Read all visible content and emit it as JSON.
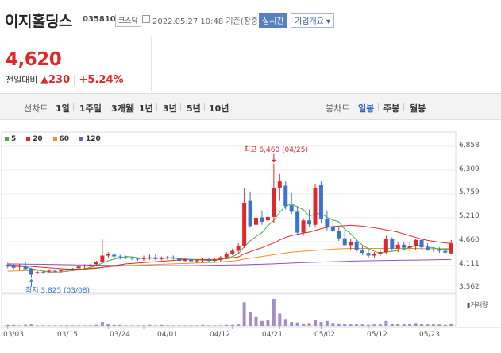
{
  "header": {
    "name": "이지홀딩스",
    "code": "035810",
    "market": "코스닥",
    "datetime": "2022.05.27 10:48 기준(장중)",
    "realtime_label": "실시간",
    "info_label": "기업개요 ▾"
  },
  "quote": {
    "price": "4,620",
    "change_label": "전일대비",
    "change_arrow": "▲",
    "change": "230",
    "percent": "+5.24%"
  },
  "tabs": {
    "line_label": "선차트",
    "line_items": [
      "1일",
      "1주일",
      "3개월",
      "1년",
      "3년",
      "5년",
      "10년"
    ],
    "candle_label": "봉차트",
    "candle_items": [
      "일봉",
      "주봉",
      "월봉"
    ],
    "selected": "일봉"
  },
  "legend": [
    {
      "label": "5",
      "color": "#3fae3f"
    },
    {
      "label": "20",
      "color": "#e0282b"
    },
    {
      "label": "60",
      "color": "#f0901e"
    },
    {
      "label": "120",
      "color": "#8a55b8"
    }
  ],
  "annotations": {
    "high": "최고 6,460 (04/25)",
    "low": "최저 3,825 (03/08)"
  },
  "volume_label": "▮거래량",
  "colors": {
    "up": "#e0282b",
    "down": "#3a74cf",
    "accent": "#2f5fbf"
  },
  "chart_data": {
    "type": "candlestick",
    "y_ticks": [
      6858,
      6309,
      5759,
      5210,
      4660,
      4111,
      3562
    ],
    "y_tick_labels": [
      "6,858",
      "6,309",
      "5,759",
      "5,210",
      "4,660",
      "4,111",
      "3,562"
    ],
    "x_tick_labels": [
      "03/03",
      "03/15",
      "03/24",
      "04/01",
      "04/12",
      "04/21",
      "05/02",
      "05/12",
      "05/23"
    ],
    "ylim": [
      3562,
      6858
    ],
    "candles": [
      {
        "o": 4130,
        "h": 4180,
        "l": 4050,
        "c": 4090
      },
      {
        "o": 4100,
        "h": 4140,
        "l": 4030,
        "c": 4060
      },
      {
        "o": 4080,
        "h": 4150,
        "l": 4000,
        "c": 4120
      },
      {
        "o": 4110,
        "h": 4190,
        "l": 4010,
        "c": 4030
      },
      {
        "o": 4040,
        "h": 4060,
        "l": 3825,
        "c": 3900
      },
      {
        "o": 3950,
        "h": 4000,
        "l": 3900,
        "c": 3960
      },
      {
        "o": 3960,
        "h": 3990,
        "l": 3920,
        "c": 3940
      },
      {
        "o": 3980,
        "h": 4030,
        "l": 3950,
        "c": 3990
      },
      {
        "o": 3990,
        "h": 4010,
        "l": 3960,
        "c": 3980
      },
      {
        "o": 3990,
        "h": 4020,
        "l": 3950,
        "c": 4000
      },
      {
        "o": 4000,
        "h": 4050,
        "l": 3970,
        "c": 4030
      },
      {
        "o": 4030,
        "h": 4060,
        "l": 3990,
        "c": 4040
      },
      {
        "o": 4050,
        "h": 4110,
        "l": 4020,
        "c": 4090
      },
      {
        "o": 4090,
        "h": 4140,
        "l": 4040,
        "c": 4110
      },
      {
        "o": 4110,
        "h": 4150,
        "l": 4080,
        "c": 4130
      },
      {
        "o": 4140,
        "h": 4220,
        "l": 4110,
        "c": 4190
      },
      {
        "o": 4200,
        "h": 4730,
        "l": 4180,
        "c": 4340
      },
      {
        "o": 4340,
        "h": 4420,
        "l": 4280,
        "c": 4380
      },
      {
        "o": 4360,
        "h": 4400,
        "l": 4290,
        "c": 4320
      },
      {
        "o": 4320,
        "h": 4360,
        "l": 4250,
        "c": 4300
      },
      {
        "o": 4300,
        "h": 4340,
        "l": 4260,
        "c": 4290
      },
      {
        "o": 4290,
        "h": 4320,
        "l": 4240,
        "c": 4270
      },
      {
        "o": 4270,
        "h": 4300,
        "l": 4220,
        "c": 4260
      },
      {
        "o": 4260,
        "h": 4340,
        "l": 4220,
        "c": 4280
      },
      {
        "o": 4280,
        "h": 4360,
        "l": 4240,
        "c": 4300
      },
      {
        "o": 4300,
        "h": 4380,
        "l": 4240,
        "c": 4260
      },
      {
        "o": 4260,
        "h": 4320,
        "l": 4230,
        "c": 4290
      },
      {
        "o": 4290,
        "h": 4330,
        "l": 4250,
        "c": 4300
      },
      {
        "o": 4300,
        "h": 4340,
        "l": 4250,
        "c": 4270
      },
      {
        "o": 4270,
        "h": 4300,
        "l": 4200,
        "c": 4220
      },
      {
        "o": 4220,
        "h": 4290,
        "l": 4200,
        "c": 4260
      },
      {
        "o": 4260,
        "h": 4300,
        "l": 4190,
        "c": 4210
      },
      {
        "o": 4210,
        "h": 4260,
        "l": 4170,
        "c": 4230
      },
      {
        "o": 4230,
        "h": 4280,
        "l": 4190,
        "c": 4250
      },
      {
        "o": 4250,
        "h": 4300,
        "l": 4200,
        "c": 4220
      },
      {
        "o": 4220,
        "h": 4280,
        "l": 4190,
        "c": 4240
      },
      {
        "o": 4240,
        "h": 4330,
        "l": 4200,
        "c": 4300
      },
      {
        "o": 4300,
        "h": 4420,
        "l": 4260,
        "c": 4380
      },
      {
        "o": 4380,
        "h": 4500,
        "l": 4350,
        "c": 4450
      },
      {
        "o": 4450,
        "h": 4620,
        "l": 4380,
        "c": 4560
      },
      {
        "o": 4560,
        "h": 5900,
        "l": 4520,
        "c": 5560
      },
      {
        "o": 5600,
        "h": 5820,
        "l": 4980,
        "c": 5020
      },
      {
        "o": 5050,
        "h": 5600,
        "l": 4990,
        "c": 5210
      },
      {
        "o": 5220,
        "h": 5380,
        "l": 5050,
        "c": 5120
      },
      {
        "o": 5150,
        "h": 5320,
        "l": 5000,
        "c": 5230
      },
      {
        "o": 5230,
        "h": 6460,
        "l": 5100,
        "c": 5900
      },
      {
        "o": 5900,
        "h": 6220,
        "l": 5600,
        "c": 6050
      },
      {
        "o": 5950,
        "h": 6050,
        "l": 5400,
        "c": 5480
      },
      {
        "o": 5500,
        "h": 5780,
        "l": 5300,
        "c": 5350
      },
      {
        "o": 5350,
        "h": 5480,
        "l": 4800,
        "c": 4870
      },
      {
        "o": 4870,
        "h": 5200,
        "l": 4800,
        "c": 5150
      },
      {
        "o": 5150,
        "h": 5400,
        "l": 5000,
        "c": 5060
      },
      {
        "o": 5050,
        "h": 6000,
        "l": 5000,
        "c": 5900
      },
      {
        "o": 5960,
        "h": 6050,
        "l": 5100,
        "c": 5180
      },
      {
        "o": 5180,
        "h": 5380,
        "l": 4920,
        "c": 5000
      },
      {
        "o": 5000,
        "h": 5150,
        "l": 4880,
        "c": 4910
      },
      {
        "o": 4900,
        "h": 5000,
        "l": 4680,
        "c": 4740
      },
      {
        "o": 4740,
        "h": 4900,
        "l": 4550,
        "c": 4580
      },
      {
        "o": 4580,
        "h": 4720,
        "l": 4480,
        "c": 4650
      },
      {
        "o": 4650,
        "h": 4720,
        "l": 4430,
        "c": 4470
      },
      {
        "o": 4470,
        "h": 4560,
        "l": 4350,
        "c": 4400
      },
      {
        "o": 4400,
        "h": 4480,
        "l": 4280,
        "c": 4340
      },
      {
        "o": 4340,
        "h": 4420,
        "l": 4300,
        "c": 4380
      },
      {
        "o": 4380,
        "h": 4480,
        "l": 4330,
        "c": 4420
      },
      {
        "o": 4420,
        "h": 4800,
        "l": 4380,
        "c": 4720
      },
      {
        "o": 4720,
        "h": 4760,
        "l": 4450,
        "c": 4500
      },
      {
        "o": 4500,
        "h": 4640,
        "l": 4420,
        "c": 4590
      },
      {
        "o": 4590,
        "h": 4660,
        "l": 4470,
        "c": 4520
      },
      {
        "o": 4520,
        "h": 4650,
        "l": 4440,
        "c": 4560
      },
      {
        "o": 4560,
        "h": 4720,
        "l": 4470,
        "c": 4700
      },
      {
        "o": 4700,
        "h": 4720,
        "l": 4480,
        "c": 4530
      },
      {
        "o": 4530,
        "h": 4620,
        "l": 4450,
        "c": 4480
      },
      {
        "o": 4480,
        "h": 4540,
        "l": 4420,
        "c": 4470
      },
      {
        "o": 4480,
        "h": 4530,
        "l": 4400,
        "c": 4450
      },
      {
        "o": 4450,
        "h": 4520,
        "l": 4380,
        "c": 4410
      },
      {
        "o": 4390,
        "h": 4700,
        "l": 4380,
        "c": 4620
      }
    ],
    "ma": {
      "5": [
        4100,
        4095,
        4090,
        4080,
        4040,
        4010,
        3980,
        3960,
        3960,
        3965,
        3980,
        3995,
        4010,
        4040,
        4070,
        4105,
        4170,
        4220,
        4260,
        4290,
        4320,
        4310,
        4290,
        4280,
        4280,
        4285,
        4285,
        4280,
        4285,
        4270,
        4260,
        4250,
        4240,
        4240,
        4230,
        4235,
        4250,
        4280,
        4320,
        4380,
        4540,
        4680,
        4780,
        4870,
        5030,
        5150,
        5340,
        5480,
        5530,
        5460,
        5400,
        5250,
        5300,
        5310,
        5220,
        5160,
        5120,
        4950,
        4840,
        4700,
        4580,
        4500,
        4440,
        4400,
        4420,
        4440,
        4460,
        4480,
        4530,
        4570,
        4580,
        4540,
        4520,
        4490,
        4480,
        4500
      ],
      "20": [
        4130,
        4120,
        4110,
        4100,
        4090,
        4080,
        4070,
        4060,
        4050,
        4040,
        4030,
        4030,
        4030,
        4030,
        4040,
        4050,
        4070,
        4090,
        4110,
        4130,
        4150,
        4160,
        4170,
        4180,
        4190,
        4200,
        4210,
        4220,
        4230,
        4240,
        4250,
        4250,
        4250,
        4250,
        4250,
        4250,
        4260,
        4270,
        4290,
        4310,
        4380,
        4430,
        4480,
        4520,
        4580,
        4630,
        4700,
        4760,
        4800,
        4830,
        4860,
        4880,
        4920,
        4960,
        4990,
        5010,
        5020,
        5030,
        5040,
        5030,
        5020,
        5000,
        4980,
        4960,
        4930,
        4910,
        4880,
        4840,
        4800,
        4760,
        4720,
        4690,
        4670,
        4650,
        4630,
        4620
      ],
      "60": [
        3980,
        3985,
        3990,
        3995,
        4000,
        4005,
        4005,
        4005,
        4010,
        4015,
        4020,
        4025,
        4030,
        4040,
        4050,
        4060,
        4070,
        4080,
        4090,
        4100,
        4110,
        4115,
        4120,
        4125,
        4130,
        4135,
        4140,
        4145,
        4150,
        4155,
        4160,
        4165,
        4170,
        4175,
        4180,
        4185,
        4195,
        4205,
        4215,
        4230,
        4260,
        4280,
        4300,
        4320,
        4340,
        4360,
        4380,
        4400,
        4420,
        4430,
        4440,
        4450,
        4460,
        4470,
        4480,
        4490,
        4495,
        4500,
        4505,
        4505,
        4505,
        4505,
        4505,
        4505,
        4505,
        4505,
        4505,
        4505,
        4505,
        4505,
        4500,
        4500,
        4500,
        4500,
        4500,
        4500
      ],
      "120": [
        4150,
        4148,
        4146,
        4144,
        4142,
        4140,
        4138,
        4136,
        4134,
        4132,
        4130,
        4128,
        4126,
        4124,
        4122,
        4120,
        4118,
        4117,
        4116,
        4115,
        4114,
        4113,
        4112,
        4111,
        4110,
        4110,
        4110,
        4110,
        4110,
        4110,
        4110,
        4110,
        4112,
        4114,
        4116,
        4118,
        4120,
        4122,
        4124,
        4126,
        4130,
        4134,
        4138,
        4142,
        4146,
        4150,
        4156,
        4162,
        4168,
        4174,
        4180,
        4184,
        4188,
        4192,
        4196,
        4200,
        4204,
        4208,
        4212,
        4216,
        4220,
        4222,
        4224,
        4226,
        4228,
        4230,
        4232,
        4234,
        4236,
        4238,
        4240,
        4242,
        4244,
        4246,
        4248,
        4250
      ]
    },
    "volume": [
      2,
      2,
      1,
      2,
      3,
      1,
      1,
      1,
      1,
      1,
      1,
      1,
      1,
      1,
      1,
      2,
      8,
      4,
      2,
      2,
      1,
      1,
      1,
      1,
      2,
      1,
      2,
      1,
      1,
      1,
      1,
      1,
      1,
      2,
      1,
      1,
      1,
      2,
      2,
      3,
      48,
      28,
      18,
      10,
      12,
      55,
      25,
      14,
      8,
      7,
      5,
      6,
      12,
      8,
      10,
      6,
      5,
      4,
      3,
      3,
      3,
      2,
      3,
      3,
      10,
      5,
      4,
      4,
      5,
      6,
      4,
      3,
      3,
      3,
      2,
      5
    ]
  }
}
